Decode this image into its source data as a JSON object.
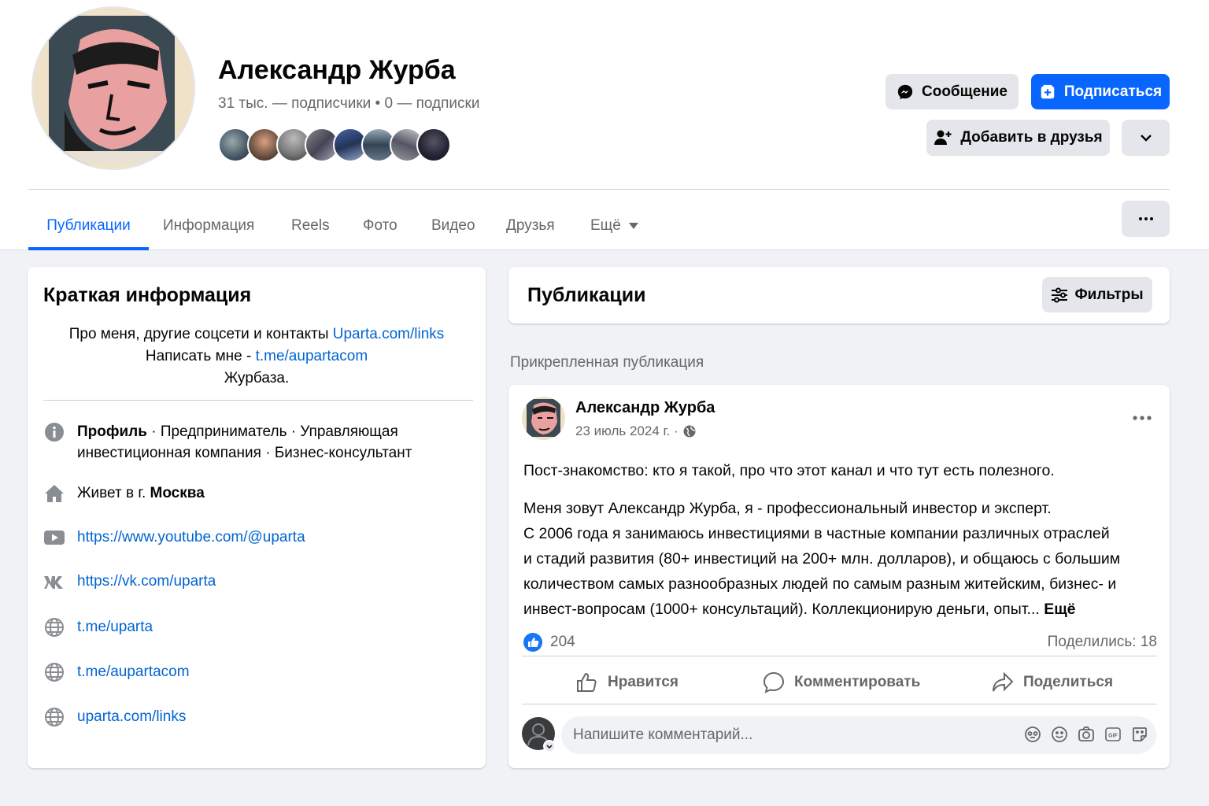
{
  "profile": {
    "name": "Александр Журба",
    "followers": "31 тыс. — подписчики",
    "dot": "•",
    "following": "0 — подписки",
    "buttons": {
      "message": "Сообщение",
      "follow": "Подписаться",
      "add_friend": "Добавить в друзья"
    }
  },
  "tabs": [
    "Публикации",
    "Информация",
    "Reels",
    "Фото",
    "Видео",
    "Друзья",
    "Ещё"
  ],
  "intro": {
    "title": "Краткая информация",
    "bio_line1": "Про меня, другие соцсети и контакты ",
    "bio_link1": "Uparta.com/links",
    "bio_line2": "Написать мне - ",
    "bio_link2": "t.me/aupartacom",
    "bio_line3": "Журбаза.",
    "profile_label": "Профиль",
    "profile_text": " · Предприниматель · Управляющая инвестиционная компания · Бизнес-консультант",
    "lives_prefix": "Живет в г. ",
    "lives_city": "Москва",
    "links": [
      "https://www.youtube.com/@uparta",
      "https://vk.com/uparta",
      "t.me/uparta",
      "t.me/aupartacom",
      "uparta.com/links"
    ]
  },
  "posts": {
    "title": "Публикации",
    "filters": "Фильтры",
    "pinned_label": "Прикрепленная публикация"
  },
  "post": {
    "author": "Александр Журба",
    "date": "23 июль 2024 г. ·",
    "para1": "Пост-знакомство: кто я такой, про что этот канал и что тут есть полезного.",
    "para2_line1": "Меня зовут Александр Журба, я - профессиональный инвестор и эксперт.",
    "para2_line2": "С 2006 года я занимаюсь инвестициями в частные компании различных отраслей и стадий развития (80+ инвестиций на 200+ млн. долларов), и общаюсь с большим количеством самых разнообразных людей по самым разным житейским, бизнес- и инвест-вопросам (1000+ консультаций). Коллекционирую деньги, опыт... ",
    "more": "Ещё",
    "likes": "204",
    "shares": "Поделились: 18",
    "actions": {
      "like": "Нравится",
      "comment": "Комментировать",
      "share": "Поделиться"
    },
    "comment_placeholder": "Напишите комментарий..."
  },
  "colors": {
    "accent": "#0866ff",
    "link": "#0064d1",
    "secondary_text": "#65676b"
  }
}
